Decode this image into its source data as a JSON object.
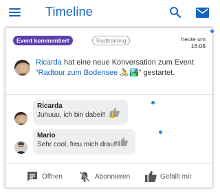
{
  "app_bar": {
    "title": "Timeline",
    "icons": [
      "menu-icon",
      "search-icon",
      "mail-icon"
    ],
    "accent_color": "#1565c0"
  },
  "card": {
    "event_badge": "Event kommentiert",
    "tag_badge": "Radtraining",
    "timestamp_line1": "heute um",
    "timestamp_line2": "16:08",
    "post": {
      "actor": "Ricarda",
      "text_before_event": " hat eine neue Konversation zum Event “",
      "event_name": "Radtour zum Bodensee",
      "event_emoji": "🚴🏞️",
      "text_after": "” gestartet."
    },
    "comments": [
      {
        "author": "Ricarda",
        "text": "Juhuuu, ich bin dabei!! 💪"
      },
      {
        "author": "Mario",
        "text": "Sehr cool, freu mich drauf!"
      }
    ],
    "actions": {
      "open": "Öffnen",
      "subscribe": "Abonnieren",
      "like": "Gefällt mir"
    },
    "colors": {
      "badge_bg": "#5b3fb0",
      "unread_dot": "#1e88e5",
      "link": "#1565c0"
    }
  }
}
